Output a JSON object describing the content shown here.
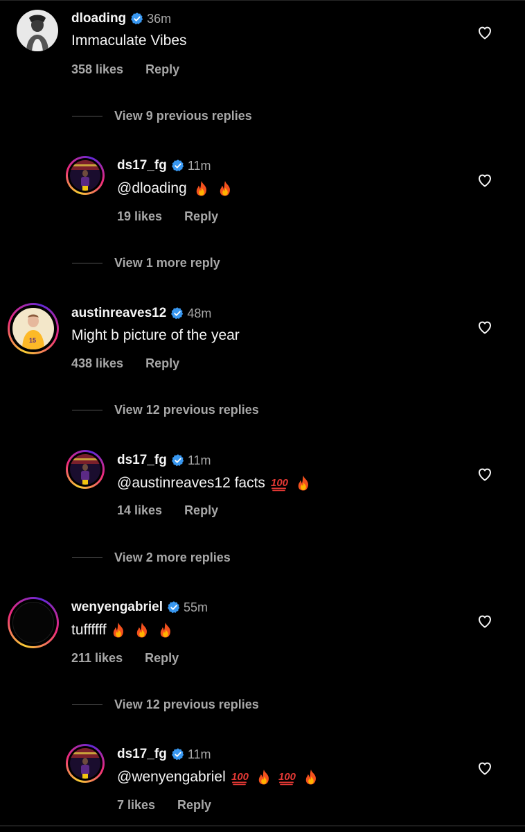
{
  "colors": {
    "background": "#000000",
    "text": "#f5f5f5",
    "muted": "#a8a8a8",
    "verified": "#3897f0"
  },
  "threads": [
    {
      "username": "dloading",
      "time": "36m",
      "text": "Immaculate Vibes",
      "likes": "358 likes",
      "reply": "Reply",
      "view_replies": "View 9 previous replies",
      "reply_comment": {
        "username": "ds17_fg",
        "time": "11m",
        "text": "@dloading",
        "emojis": [
          "fire",
          "fire"
        ],
        "likes": "19 likes",
        "reply": "Reply"
      },
      "more": "View 1 more reply"
    },
    {
      "username": "austinreaves12",
      "time": "48m",
      "text": "Might b picture of the year",
      "likes": "438 likes",
      "reply": "Reply",
      "view_replies": "View 12 previous replies",
      "reply_comment": {
        "username": "ds17_fg",
        "time": "11m",
        "text": "@austinreaves12 facts",
        "emojis": [
          "hundred",
          "fire"
        ],
        "likes": "14 likes",
        "reply": "Reply"
      },
      "more": "View 2 more replies"
    },
    {
      "username": "wenyengabriel",
      "time": "55m",
      "text": "tuffffff",
      "emojis": [
        "fire",
        "fire",
        "fire"
      ],
      "likes": "211 likes",
      "reply": "Reply",
      "view_replies": "View 12 previous replies",
      "reply_comment": {
        "username": "ds17_fg",
        "time": "11m",
        "text": "@wenyengabriel",
        "emojis": [
          "hundred",
          "fire",
          "hundred",
          "fire"
        ],
        "likes": "7 likes",
        "reply": "Reply"
      }
    }
  ]
}
